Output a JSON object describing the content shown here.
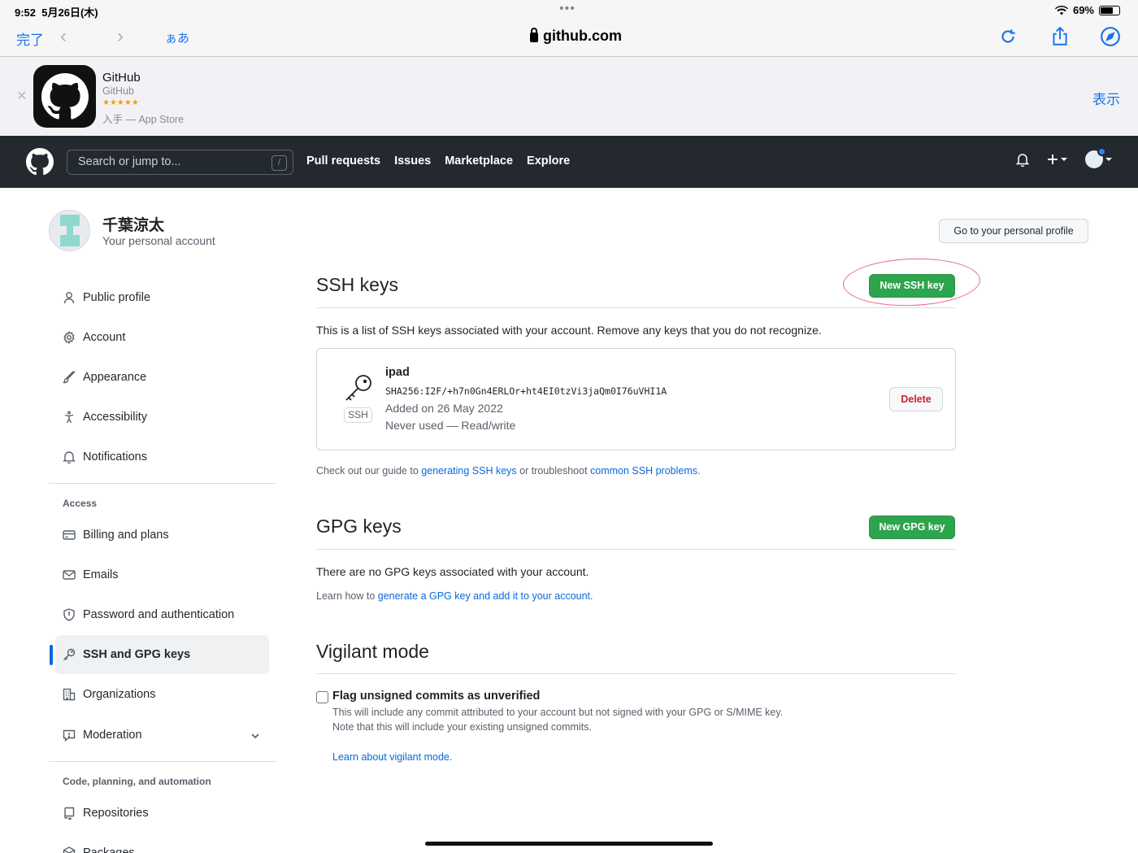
{
  "status": {
    "time": "9:52",
    "date": "5月26日(木)",
    "battery": "69%"
  },
  "safari": {
    "done": "完了",
    "aa": "ぁあ",
    "url": "github.com"
  },
  "banner": {
    "app_name": "GitHub",
    "developer": "GitHub",
    "stars": "★★★★★",
    "store": "入手 — App Store",
    "view": "表示"
  },
  "header": {
    "search_placeholder": "Search or jump to...",
    "search_shortcut": "/",
    "nav": [
      "Pull requests",
      "Issues",
      "Marketplace",
      "Explore"
    ]
  },
  "profile": {
    "name": "千葉涼太",
    "subtitle": "Your personal account",
    "goto": "Go to your personal profile"
  },
  "sidebar": {
    "items": [
      {
        "label": "Public profile",
        "icon": "person-icon"
      },
      {
        "label": "Account",
        "icon": "gear-icon"
      },
      {
        "label": "Appearance",
        "icon": "paintbrush-icon"
      },
      {
        "label": "Accessibility",
        "icon": "accessibility-icon"
      },
      {
        "label": "Notifications",
        "icon": "bell-icon"
      }
    ],
    "access_heading": "Access",
    "access_items": [
      {
        "label": "Billing and plans",
        "icon": "credit-card-icon"
      },
      {
        "label": "Emails",
        "icon": "mail-icon"
      },
      {
        "label": "Password and authentication",
        "icon": "shield-icon"
      },
      {
        "label": "SSH and GPG keys",
        "icon": "key-icon"
      },
      {
        "label": "Organizations",
        "icon": "organization-icon"
      },
      {
        "label": "Moderation",
        "icon": "report-icon"
      }
    ],
    "code_heading": "Code, planning, and automation",
    "code_items": [
      {
        "label": "Repositories",
        "icon": "repo-icon"
      },
      {
        "label": "Packages",
        "icon": "package-icon"
      }
    ]
  },
  "ssh": {
    "title": "SSH keys",
    "new_button": "New SSH key",
    "description": "This is a list of SSH keys associated with your account. Remove any keys that you do not recognize.",
    "key": {
      "title": "ipad",
      "fingerprint": "SHA256:I2F/+h7n0Gn4ERLOr+ht4EI0tzVi3jaQm0I76uVHI1A",
      "added": "Added on 26 May 2022",
      "used": "Never used — Read/write",
      "badge": "SSH",
      "delete": "Delete"
    },
    "guide_prefix": "Check out our guide to ",
    "guide_link1": "generating SSH keys",
    "guide_middle": " or troubleshoot ",
    "guide_link2": "common SSH problems",
    "guide_suffix": "."
  },
  "gpg": {
    "title": "GPG keys",
    "new_button": "New GPG key",
    "empty": "There are no GPG keys associated with your account.",
    "learn_prefix": "Learn how to ",
    "learn_link": "generate a GPG key and add it to your account",
    "learn_suffix": "."
  },
  "vigilant": {
    "title": "Vigilant mode",
    "checkbox_label": "Flag unsigned commits as unverified",
    "desc1": "This will include any commit attributed to your account but not signed with your GPG or S/MIME key.",
    "desc2": "Note that this will include your existing unsigned commits.",
    "learn": "Learn about vigilant mode."
  }
}
